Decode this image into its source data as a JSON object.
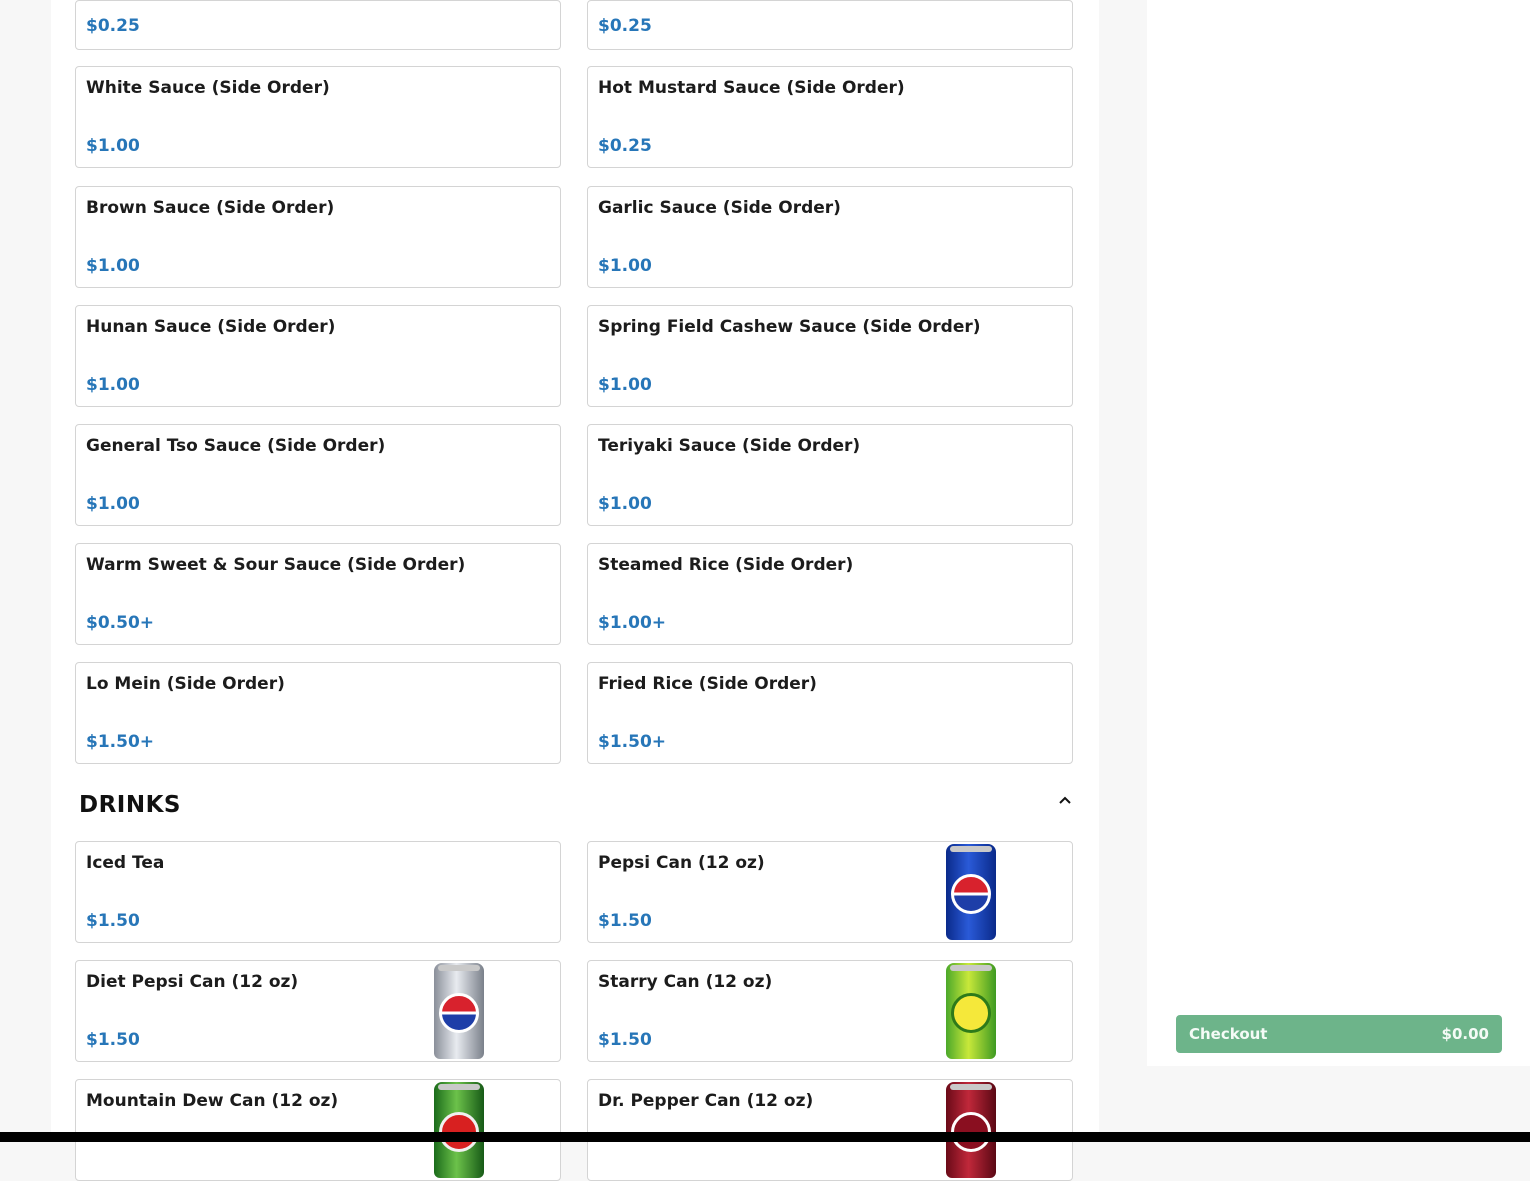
{
  "side_orders": {
    "partial_row": {
      "left_price": "$0.25",
      "right_price": "$0.25"
    },
    "rows": [
      {
        "left": {
          "name": "White Sauce (Side Order)",
          "price": "$1.00"
        },
        "right": {
          "name": "Hot Mustard Sauce (Side Order)",
          "price": "$0.25"
        }
      },
      {
        "left": {
          "name": "Brown Sauce (Side Order)",
          "price": "$1.00"
        },
        "right": {
          "name": "Garlic Sauce (Side Order)",
          "price": "$1.00"
        }
      },
      {
        "left": {
          "name": "Hunan Sauce (Side Order)",
          "price": "$1.00"
        },
        "right": {
          "name": "Spring Field Cashew Sauce (Side Order)",
          "price": "$1.00"
        }
      },
      {
        "left": {
          "name": "General Tso Sauce (Side Order)",
          "price": "$1.00"
        },
        "right": {
          "name": "Teriyaki Sauce (Side Order)",
          "price": "$1.00"
        }
      },
      {
        "left": {
          "name": "Warm Sweet & Sour Sauce (Side Order)",
          "price": "$0.50+"
        },
        "right": {
          "name": "Steamed Rice (Side Order)",
          "price": "$1.00+"
        }
      },
      {
        "left": {
          "name": "Lo Mein (Side Order)",
          "price": "$1.50+"
        },
        "right": {
          "name": "Fried Rice (Side Order)",
          "price": "$1.50+"
        }
      }
    ]
  },
  "drinks": {
    "title": "DRINKS",
    "collapse_icon": "chevron-up-icon",
    "rows": [
      {
        "left": {
          "name": "Iced Tea",
          "price": "$1.50"
        },
        "right": {
          "name": "Pepsi Can (12 oz)",
          "price": "$1.50",
          "image": "pepsi-can"
        }
      },
      {
        "left": {
          "name": "Diet Pepsi Can (12 oz)",
          "price": "$1.50",
          "image": "diet-pepsi-can"
        },
        "right": {
          "name": "Starry Can (12 oz)",
          "price": "$1.50",
          "image": "starry-can"
        }
      },
      {
        "left": {
          "name": "Mountain Dew Can (12 oz)",
          "image": "mountain-dew-can"
        },
        "right": {
          "name": "Dr. Pepper Can (12 oz)",
          "image": "dr-pepper-can"
        }
      }
    ]
  },
  "cart": {
    "checkout_label": "Checkout",
    "total": "$0.00"
  },
  "colors": {
    "price": "#2776b8",
    "checkout": "#6db48a"
  }
}
